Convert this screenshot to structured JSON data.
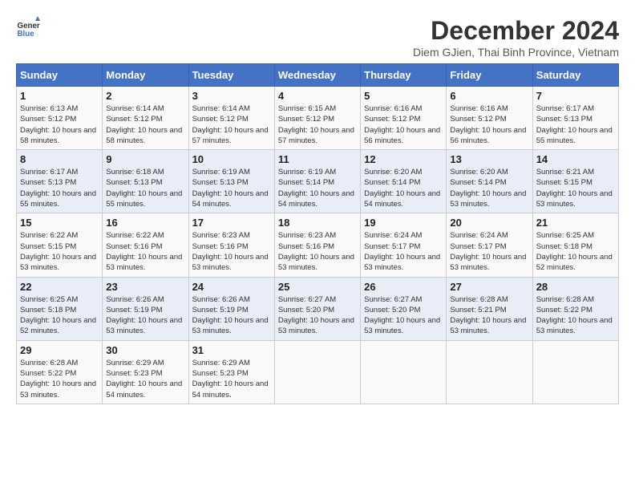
{
  "logo": {
    "text_top": "General",
    "text_bottom": "Blue"
  },
  "title": "December 2024",
  "subtitle": "Diem GJien, Thai Binh Province, Vietnam",
  "headers": [
    "Sunday",
    "Monday",
    "Tuesday",
    "Wednesday",
    "Thursday",
    "Friday",
    "Saturday"
  ],
  "weeks": [
    [
      {
        "day": "1",
        "sunrise": "6:13 AM",
        "sunset": "5:12 PM",
        "daylight": "10 hours and 58 minutes."
      },
      {
        "day": "2",
        "sunrise": "6:14 AM",
        "sunset": "5:12 PM",
        "daylight": "10 hours and 58 minutes."
      },
      {
        "day": "3",
        "sunrise": "6:14 AM",
        "sunset": "5:12 PM",
        "daylight": "10 hours and 57 minutes."
      },
      {
        "day": "4",
        "sunrise": "6:15 AM",
        "sunset": "5:12 PM",
        "daylight": "10 hours and 57 minutes."
      },
      {
        "day": "5",
        "sunrise": "6:16 AM",
        "sunset": "5:12 PM",
        "daylight": "10 hours and 56 minutes."
      },
      {
        "day": "6",
        "sunrise": "6:16 AM",
        "sunset": "5:12 PM",
        "daylight": "10 hours and 56 minutes."
      },
      {
        "day": "7",
        "sunrise": "6:17 AM",
        "sunset": "5:13 PM",
        "daylight": "10 hours and 55 minutes."
      }
    ],
    [
      {
        "day": "8",
        "sunrise": "6:17 AM",
        "sunset": "5:13 PM",
        "daylight": "10 hours and 55 minutes."
      },
      {
        "day": "9",
        "sunrise": "6:18 AM",
        "sunset": "5:13 PM",
        "daylight": "10 hours and 55 minutes."
      },
      {
        "day": "10",
        "sunrise": "6:19 AM",
        "sunset": "5:13 PM",
        "daylight": "10 hours and 54 minutes."
      },
      {
        "day": "11",
        "sunrise": "6:19 AM",
        "sunset": "5:14 PM",
        "daylight": "10 hours and 54 minutes."
      },
      {
        "day": "12",
        "sunrise": "6:20 AM",
        "sunset": "5:14 PM",
        "daylight": "10 hours and 54 minutes."
      },
      {
        "day": "13",
        "sunrise": "6:20 AM",
        "sunset": "5:14 PM",
        "daylight": "10 hours and 53 minutes."
      },
      {
        "day": "14",
        "sunrise": "6:21 AM",
        "sunset": "5:15 PM",
        "daylight": "10 hours and 53 minutes."
      }
    ],
    [
      {
        "day": "15",
        "sunrise": "6:22 AM",
        "sunset": "5:15 PM",
        "daylight": "10 hours and 53 minutes."
      },
      {
        "day": "16",
        "sunrise": "6:22 AM",
        "sunset": "5:16 PM",
        "daylight": "10 hours and 53 minutes."
      },
      {
        "day": "17",
        "sunrise": "6:23 AM",
        "sunset": "5:16 PM",
        "daylight": "10 hours and 53 minutes."
      },
      {
        "day": "18",
        "sunrise": "6:23 AM",
        "sunset": "5:16 PM",
        "daylight": "10 hours and 53 minutes."
      },
      {
        "day": "19",
        "sunrise": "6:24 AM",
        "sunset": "5:17 PM",
        "daylight": "10 hours and 53 minutes."
      },
      {
        "day": "20",
        "sunrise": "6:24 AM",
        "sunset": "5:17 PM",
        "daylight": "10 hours and 53 minutes."
      },
      {
        "day": "21",
        "sunrise": "6:25 AM",
        "sunset": "5:18 PM",
        "daylight": "10 hours and 52 minutes."
      }
    ],
    [
      {
        "day": "22",
        "sunrise": "6:25 AM",
        "sunset": "5:18 PM",
        "daylight": "10 hours and 52 minutes."
      },
      {
        "day": "23",
        "sunrise": "6:26 AM",
        "sunset": "5:19 PM",
        "daylight": "10 hours and 53 minutes."
      },
      {
        "day": "24",
        "sunrise": "6:26 AM",
        "sunset": "5:19 PM",
        "daylight": "10 hours and 53 minutes."
      },
      {
        "day": "25",
        "sunrise": "6:27 AM",
        "sunset": "5:20 PM",
        "daylight": "10 hours and 53 minutes."
      },
      {
        "day": "26",
        "sunrise": "6:27 AM",
        "sunset": "5:20 PM",
        "daylight": "10 hours and 53 minutes."
      },
      {
        "day": "27",
        "sunrise": "6:28 AM",
        "sunset": "5:21 PM",
        "daylight": "10 hours and 53 minutes."
      },
      {
        "day": "28",
        "sunrise": "6:28 AM",
        "sunset": "5:22 PM",
        "daylight": "10 hours and 53 minutes."
      }
    ],
    [
      {
        "day": "29",
        "sunrise": "6:28 AM",
        "sunset": "5:22 PM",
        "daylight": "10 hours and 53 minutes."
      },
      {
        "day": "30",
        "sunrise": "6:29 AM",
        "sunset": "5:23 PM",
        "daylight": "10 hours and 54 minutes."
      },
      {
        "day": "31",
        "sunrise": "6:29 AM",
        "sunset": "5:23 PM",
        "daylight": "10 hours and 54 minutes."
      },
      null,
      null,
      null,
      null
    ]
  ]
}
